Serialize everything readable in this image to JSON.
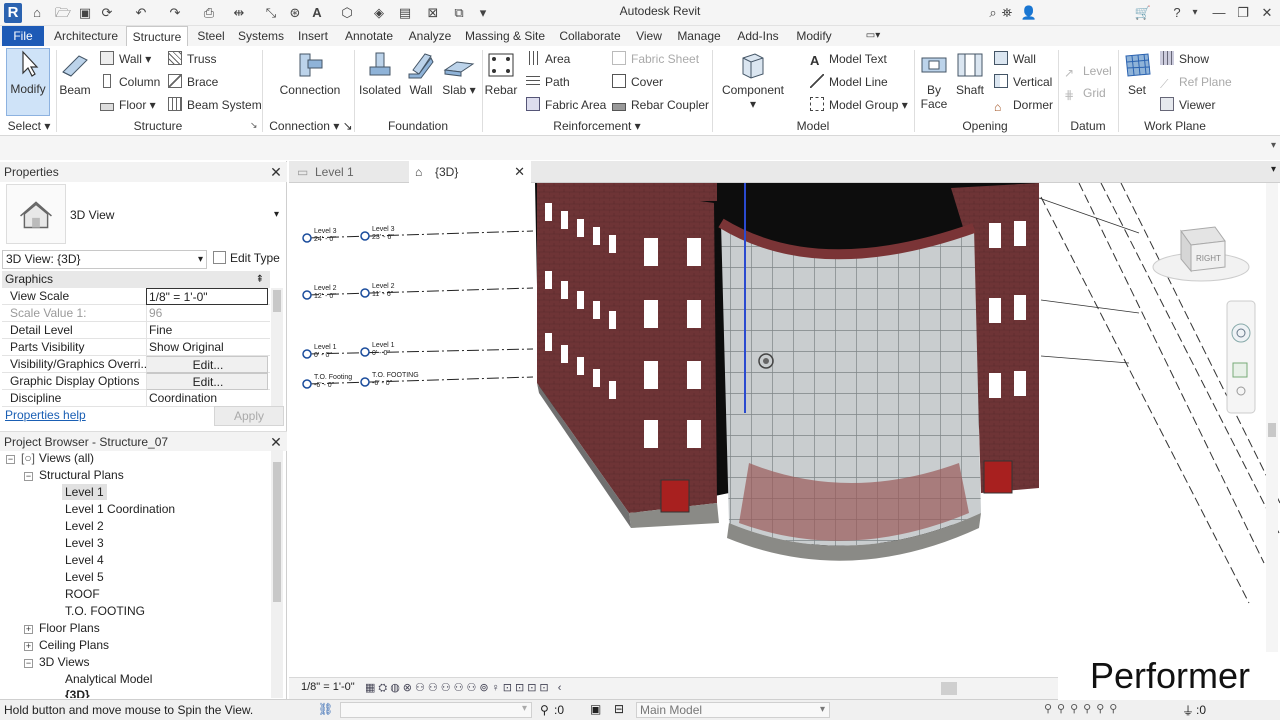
{
  "app": {
    "title": "Autodesk Revit",
    "logo": "R"
  },
  "menu_tabs": [
    "File",
    "Architecture",
    "Structure",
    "Steel",
    "Systems",
    "Insert",
    "Annotate",
    "Analyze",
    "Massing & Site",
    "Collaborate",
    "View",
    "Manage",
    "Add-Ins",
    "Modify"
  ],
  "active_tab": "Structure",
  "ribbon": {
    "select": {
      "modify": "Modify",
      "panel": "Select"
    },
    "structure": {
      "beam": "Beam",
      "wall": "Wall",
      "column": "Column",
      "floor": "Floor",
      "truss": "Truss",
      "brace": "Brace",
      "beam_system": "Beam  System",
      "panel": "Structure"
    },
    "connection": {
      "connection": "Connection",
      "panel": "Connection"
    },
    "foundation": {
      "isolated": "Isolated",
      "wall": "Wall",
      "slab": "Slab",
      "panel": "Foundation"
    },
    "reinforcement": {
      "rebar": "Rebar",
      "area": "Area",
      "path": "Path",
      "fabric_area": "Fabric  Area",
      "fabric_sheet": "Fabric  Sheet",
      "cover": "Cover",
      "rebar_coupler": "Rebar  Coupler",
      "panel": "Reinforcement"
    },
    "model": {
      "component": "Component",
      "model_text": "Model  Text",
      "model_line": "Model  Line",
      "model_group": "Model  Group",
      "panel": "Model"
    },
    "opening": {
      "by_face": "By\nFace",
      "by": "By",
      "face": "Face",
      "shaft": "Shaft",
      "wall": "Wall",
      "vertical": "Vertical",
      "dormer": "Dormer",
      "panel": "Opening"
    },
    "datum": {
      "level": "Level",
      "grid": "Grid",
      "panel": "Datum"
    },
    "work_plane": {
      "set": "Set",
      "show": "Show",
      "ref_plane": "Ref  Plane",
      "viewer": "Viewer",
      "panel": "Work Plane"
    }
  },
  "properties": {
    "title": "Properties",
    "type_name": "3D View",
    "instance_selector": "3D View: {3D}",
    "edit_type": "Edit Type",
    "group": "Graphics",
    "rows": [
      {
        "k": "View Scale",
        "v": "1/8\" = 1'-0\""
      },
      {
        "k": "Scale Value    1:",
        "v": "96"
      },
      {
        "k": "Detail Level",
        "v": "Fine"
      },
      {
        "k": "Parts Visibility",
        "v": "Show Original"
      },
      {
        "k": "Visibility/Graphics Overri...",
        "v": "Edit..."
      },
      {
        "k": "Graphic Display Options",
        "v": "Edit..."
      },
      {
        "k": "Discipline",
        "v": "Coordination"
      }
    ],
    "help": "Properties help",
    "apply": "Apply"
  },
  "browser": {
    "title": "Project Browser - Structure_07",
    "root": "Views (all)",
    "structural_plans": "Structural Plans",
    "plans": [
      "Level 1",
      "Level 1 Coordination",
      "Level 2",
      "Level 3",
      "Level 4",
      "Level 5",
      "ROOF",
      "T.O. FOOTING"
    ],
    "floor_plans": "Floor Plans",
    "ceiling_plans": "Ceiling Plans",
    "views_3d": "3D Views",
    "analytical": "Analytical Model",
    "view_3d": "{3D}"
  },
  "view_tabs": [
    "Level 1",
    "{3D}"
  ],
  "levels": [
    {
      "name": "Level 3",
      "elev": "24' - 0\"",
      "name2": "Level 3",
      "elev2": "23' - 6\""
    },
    {
      "name": "Level 2",
      "elev": "12' - 0\"",
      "name2": "Level 2",
      "elev2": "11' - 6\""
    },
    {
      "name": "Level 1",
      "elev": "0' - 0\"",
      "name2": "Level 1",
      "elev2": "0' - 0\""
    },
    {
      "name": "T.O. Footing",
      "elev": "-6' - 0\"",
      "name2": "T.O. FOOTING",
      "elev2": "-6' - 0\""
    }
  ],
  "viewcube_face": "RIGHT",
  "view_control": {
    "scale": "1/8\" = 1'-0\""
  },
  "status": {
    "hint": "Hold button and move mouse to Spin the View.",
    "count": ":0",
    "model": "Main Model",
    "filter": ":0"
  },
  "watermark": "Performer",
  "colors": {
    "file_tab": "#1d5ab6",
    "brick": "#6e3436",
    "glass": "#c9cdcf",
    "door": "#a8201f"
  }
}
